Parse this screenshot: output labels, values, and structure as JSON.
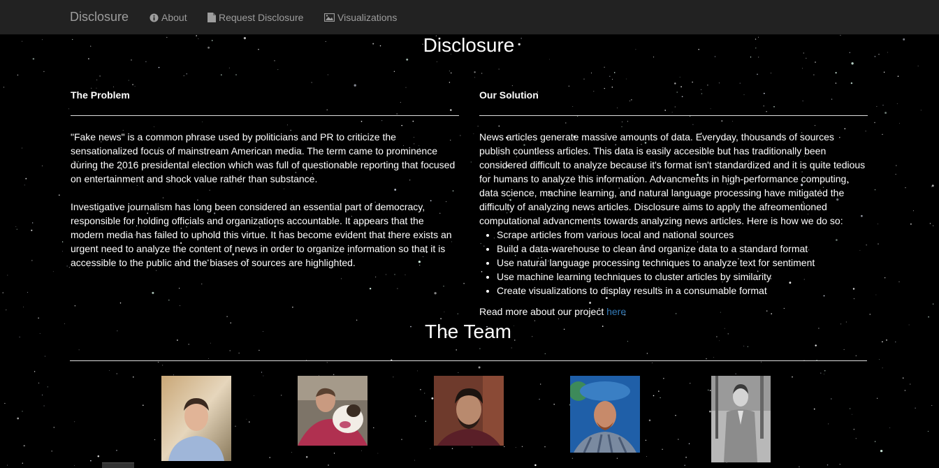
{
  "navbar": {
    "brand": "Disclosure",
    "links": [
      {
        "label": "About",
        "icon": "info-circle-icon"
      },
      {
        "label": "Request Disclosure",
        "icon": "file-icon"
      },
      {
        "label": "Visualizations",
        "icon": "picture-icon"
      }
    ]
  },
  "page": {
    "title": "Disclosure"
  },
  "problem": {
    "heading": "The Problem",
    "paragraphs": [
      "\"Fake news\" is a common phrase used by politicians and PR to criticize the sensationalized focus of mainstream American media. The term came to prominence during the 2016 presidental election which was full of questionable reporting that focused on entertainment and shock value rather than substance.",
      "Investigative journalism has long been considered an essential part of democracy, responsible for holding officials and organizations accountable. It appears that the modern media has failed to uphold this virtue. It has become evident that there exists an urgent need to analyze the content of news in order to organize information so that it is accessible to the public and the biases of sources are highlighted."
    ]
  },
  "solution": {
    "heading": "Our Solution",
    "paragraph": "News articles generate massive amounts of data. Everyday, thousands of sources publish countless articles. This data is easily accesible but has traditionally been considered difficult to analyze because it's format isn't standardized and it is quite tedious for humans to analyze this information. Advancments in high-performance computing, data science, machine learning, and natural language processing have mitigated the difficulty of analyzing news articles. Disclosure aims to apply the afreomentioned computational advancments towards analyzing news articles. Here is how we do so:",
    "steps": [
      "Scrape articles from various local and national sources",
      "Build a data-warehouse to clean and organize data to a standard format",
      "Use natural language processing techniques to analyze text for sentiment",
      "Use machine learning techniques to cluster articles by similarity",
      "Create visualizations to display results in a consumable format"
    ],
    "readmore_text": "Read more about our project ",
    "readmore_link": "here"
  },
  "team": {
    "title": "The Team"
  },
  "colors": {
    "navbar_bg": "#222222",
    "nav_text": "#9d9d9d",
    "link": "#337ab7",
    "background": "#000000"
  }
}
